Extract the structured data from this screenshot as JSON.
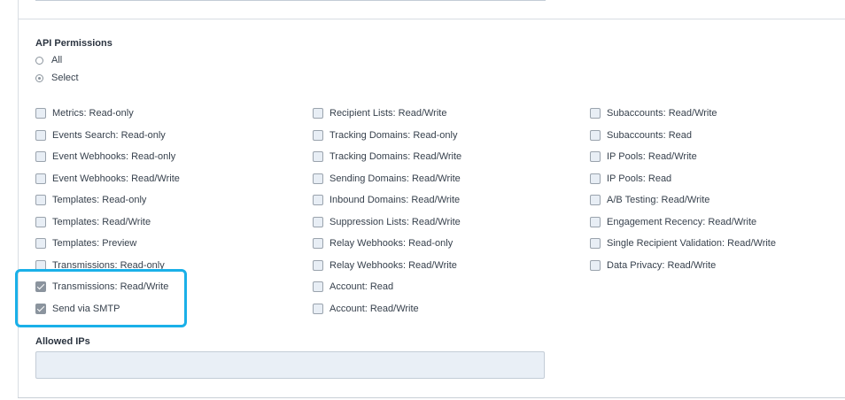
{
  "api_permissions": {
    "heading": "API Permissions",
    "mode_options": [
      {
        "label": "All",
        "selected": false
      },
      {
        "label": "Select",
        "selected": true
      }
    ],
    "columns": [
      [
        {
          "label": "Metrics: Read-only",
          "checked": false
        },
        {
          "label": "Events Search: Read-only",
          "checked": false
        },
        {
          "label": "Event Webhooks: Read-only",
          "checked": false
        },
        {
          "label": "Event Webhooks: Read/Write",
          "checked": false
        },
        {
          "label": "Templates: Read-only",
          "checked": false
        },
        {
          "label": "Templates: Read/Write",
          "checked": false
        },
        {
          "label": "Templates: Preview",
          "checked": false
        },
        {
          "label": "Transmissions: Read-only",
          "checked": false
        },
        {
          "label": "Transmissions: Read/Write",
          "checked": true
        },
        {
          "label": "Send via SMTP",
          "checked": true
        }
      ],
      [
        {
          "label": "Recipient Lists: Read/Write",
          "checked": false
        },
        {
          "label": "Tracking Domains: Read-only",
          "checked": false
        },
        {
          "label": "Tracking Domains: Read/Write",
          "checked": false
        },
        {
          "label": "Sending Domains: Read/Write",
          "checked": false
        },
        {
          "label": "Inbound Domains: Read/Write",
          "checked": false
        },
        {
          "label": "Suppression Lists: Read/Write",
          "checked": false
        },
        {
          "label": "Relay Webhooks: Read-only",
          "checked": false
        },
        {
          "label": "Relay Webhooks: Read/Write",
          "checked": false
        },
        {
          "label": "Account: Read",
          "checked": false
        },
        {
          "label": "Account: Read/Write",
          "checked": false
        }
      ],
      [
        {
          "label": "Subaccounts: Read/Write",
          "checked": false
        },
        {
          "label": "Subaccounts: Read",
          "checked": false
        },
        {
          "label": "IP Pools: Read/Write",
          "checked": false
        },
        {
          "label": "IP Pools: Read",
          "checked": false
        },
        {
          "label": "A/B Testing: Read/Write",
          "checked": false
        },
        {
          "label": "Engagement Recency: Read/Write",
          "checked": false
        },
        {
          "label": "Single Recipient Validation: Read/Write",
          "checked": false
        },
        {
          "label": "Data Privacy: Read/Write",
          "checked": false
        }
      ]
    ]
  },
  "allowed_ips": {
    "label": "Allowed IPs",
    "value": "",
    "placeholder": ""
  },
  "colors": {
    "highlight": "#1ab0e8",
    "checkbox_checked": "#8b949e",
    "input_background": "#e9eff6"
  }
}
